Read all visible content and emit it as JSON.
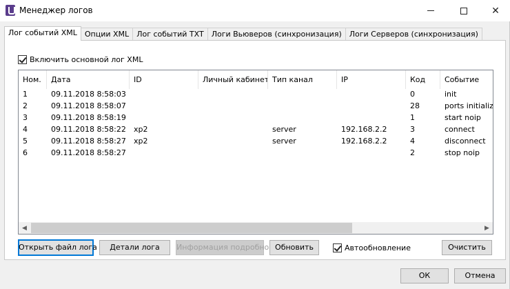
{
  "window": {
    "title": "Менеджер логов"
  },
  "tabs": [
    {
      "label": "Лог событий XML"
    },
    {
      "label": "Опции XML"
    },
    {
      "label": "Лог событий TXT"
    },
    {
      "label": "Логи Вьюверов (синхронизация)"
    },
    {
      "label": "Логи Серверов (синхронизация)"
    }
  ],
  "main_log_checkbox": {
    "label": "Включить основной лог XML",
    "checked": true
  },
  "table": {
    "columns": [
      "Ном.",
      "Дата",
      "ID",
      "Личный кабинет",
      "Тип канал",
      "IP",
      "Код",
      "Событие"
    ],
    "rows": [
      [
        "1",
        "09.11.2018 8:58:03",
        "",
        "",
        "",
        "",
        "0",
        "init"
      ],
      [
        "2",
        "09.11.2018 8:58:07",
        "",
        "",
        "",
        "",
        "28",
        "ports initializat"
      ],
      [
        "3",
        "09.11.2018 8:58:19",
        "",
        "",
        "",
        "",
        "1",
        "start noip"
      ],
      [
        "4",
        "09.11.2018 8:58:22",
        "xp2",
        "",
        "server",
        "192.168.2.2",
        "3",
        "connect"
      ],
      [
        "5",
        "09.11.2018 8:58:27",
        "xp2",
        "",
        "server",
        "192.168.2.2",
        "4",
        "disconnect"
      ],
      [
        "6",
        "09.11.2018 8:58:27",
        "",
        "",
        "",
        "",
        "2",
        "stop noip"
      ]
    ]
  },
  "buttons": {
    "open_log": "Открыть файл лога",
    "log_details": "Детали лога",
    "info_detailed": "Информация подробно",
    "refresh": "Обновить",
    "clear": "Очистить",
    "ok": "ОК",
    "cancel": "Отмена"
  },
  "auto_refresh_checkbox": {
    "label": "Автообновление",
    "checked": true
  }
}
